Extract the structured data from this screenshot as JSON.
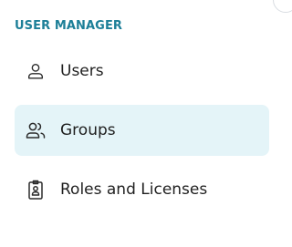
{
  "section": {
    "title": "USER MANAGER"
  },
  "nav": {
    "items": [
      {
        "label": "Users",
        "icon": "user-icon",
        "active": false
      },
      {
        "label": "Groups",
        "icon": "users-group-icon",
        "active": true
      },
      {
        "label": "Roles and Licenses",
        "icon": "id-badge-icon",
        "active": false
      }
    ]
  },
  "colors": {
    "section_title": "#1d7f98",
    "active_bg": "#e4f4f8",
    "text": "#1f1f1f",
    "icon_stroke": "#2b2b2b"
  }
}
